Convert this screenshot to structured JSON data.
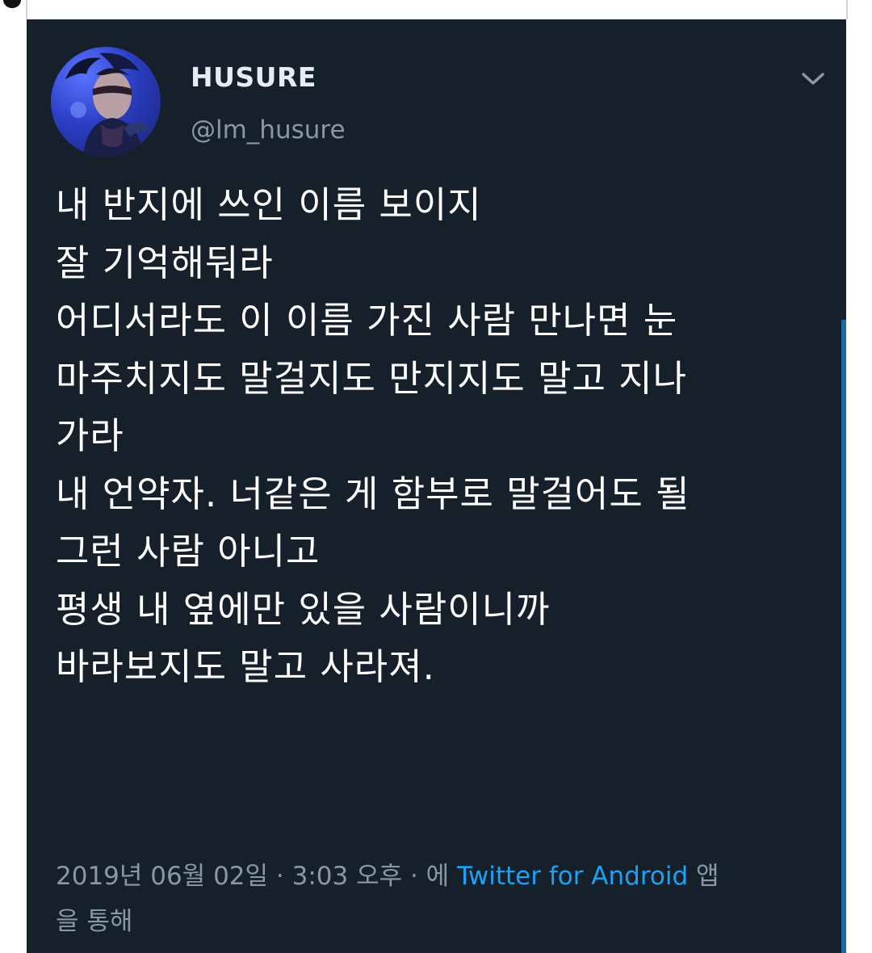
{
  "tweet": {
    "display_name": "HUSURE",
    "handle": "@lm_husure",
    "lines": [
      "내 반지에 쓰인 이름 보이지",
      "잘 기억해둬라",
      "어디서라도 이 이름 가진 사람 만나면 눈",
      "마주치지도 말걸지도 만지지도 말고 지나",
      "가라",
      "내 언약자. 너같은 게 함부로 말걸어도 될",
      "그런 사람 아니고",
      "평생 내 옆에만 있을 사람이니까",
      "바라보지도 말고 사라져."
    ],
    "timestamp": "2019년 06월 02일 · 3:03 오후 · 에",
    "source_app": "Twitter for Android",
    "via_suffix_1": "앱",
    "via_suffix_2": "을 통해"
  },
  "icons": {
    "more": "chevron-down-icon",
    "avatar": "profile-avatar"
  },
  "colors": {
    "background": "#15202b",
    "text": "#ffffff",
    "secondary_text": "#8899a6",
    "link": "#1da1f2",
    "scrollbar": "#1c6aa3"
  }
}
